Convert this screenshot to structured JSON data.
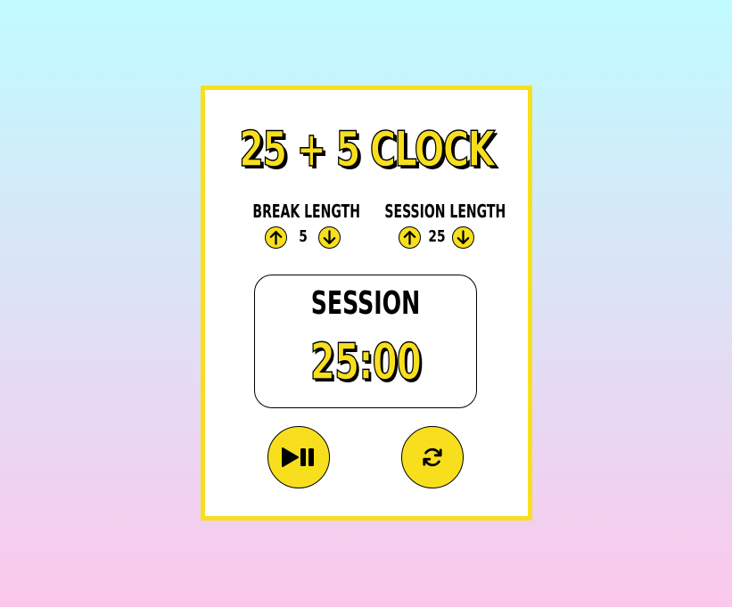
{
  "title": "25 + 5 CLOCK",
  "break": {
    "label": "BREAK LENGTH",
    "value": "5"
  },
  "session": {
    "label": "SESSION LENGTH",
    "value": "25"
  },
  "timer": {
    "label": "SESSION",
    "time_left": "25:00"
  },
  "colors": {
    "accent": "#f7df1e",
    "card": "#ffffff",
    "bg_top": "#c0fbff",
    "bg_bottom": "#fbc8ec"
  },
  "icons": {
    "increment": "arrow-up-circle-icon",
    "decrement": "arrow-down-circle-icon",
    "start_stop": "play-pause-icon",
    "reset": "refresh-icon"
  }
}
